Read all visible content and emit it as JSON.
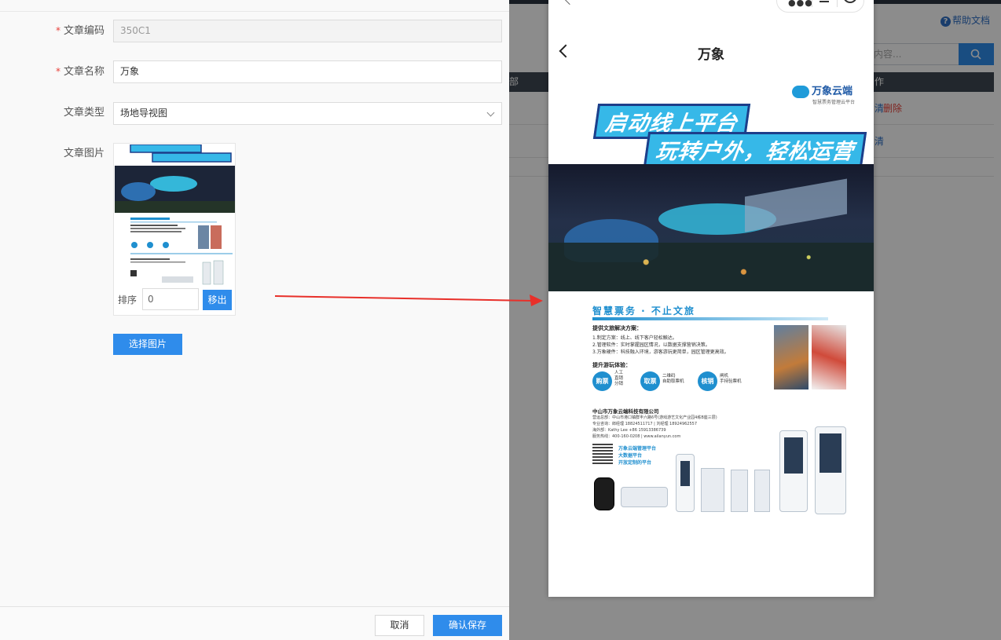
{
  "form": {
    "code": {
      "label": "文章编码",
      "value": "350C1"
    },
    "name": {
      "label": "文章名称",
      "value": "万象"
    },
    "type": {
      "label": "文章类型",
      "value": "场地导视图"
    },
    "image": {
      "label": "文章图片",
      "sort_label": "排序",
      "sort_value": "0",
      "remove_label": "移出"
    },
    "choose_image_label": "选择图片",
    "footer": {
      "cancel_label": "取消",
      "save_label": "确认保存"
    }
  },
  "background_page": {
    "help_label": "帮助文档",
    "search_placeholder": "内容...",
    "table_header": {
      "col_left": "部",
      "col_right": "作"
    },
    "rows": [
      {
        "edit": "清",
        "delete": "删除"
      },
      {
        "edit": "清",
        "delete": ""
      }
    ]
  },
  "phone": {
    "nav_title": "万象",
    "poster": {
      "logo_name": "万象云端",
      "logo_sub": "智慧票务管理云平台",
      "headline_1": "启动线上平台",
      "headline_2": "玩转户外，轻松运营",
      "section_title": "智慧票务 · 不止文旅",
      "solution_title": "提供文旅解决方案：",
      "solution_lines": [
        "1.制定方案：线上、线下客户轻松触达。",
        "2.管理软件：实时掌握园区情况，以数据支撑营销决策。",
        "3.万象硬件：科技融入环境，游客游玩更简单，园区管理更高效。"
      ],
      "experience_title": "提升游玩体验：",
      "steps": [
        {
          "label": "购票",
          "note": "人工\n直销\n分销"
        },
        {
          "label": "取票",
          "note": "二维码\n自助取票机"
        },
        {
          "label": "核销",
          "note": "闸机\n手持验票机"
        }
      ],
      "company_name": "中山市万象云端科技有限公司",
      "company_lines": [
        "营运总部：中山市港口镇群丰六路6号(游戏游艺文化产业园4栋B座三层)",
        "专业咨询：郎经理 18824511717 | 刘经理 18924962557",
        "海外部：Kathy Lee +86 15913386739",
        "服务热线：400-160-0208 | www.ailanyun.com"
      ],
      "platform_notes": [
        "万象云端管理平台",
        "大数据平台",
        "开放定制的平台"
      ]
    }
  },
  "colors": {
    "primary": "#2f8ceb",
    "danger": "#e8413a",
    "overlay": "rgba(0,0,0,0.45)",
    "poster_blue": "#1f8fcf",
    "arrow": "#e8302a"
  }
}
